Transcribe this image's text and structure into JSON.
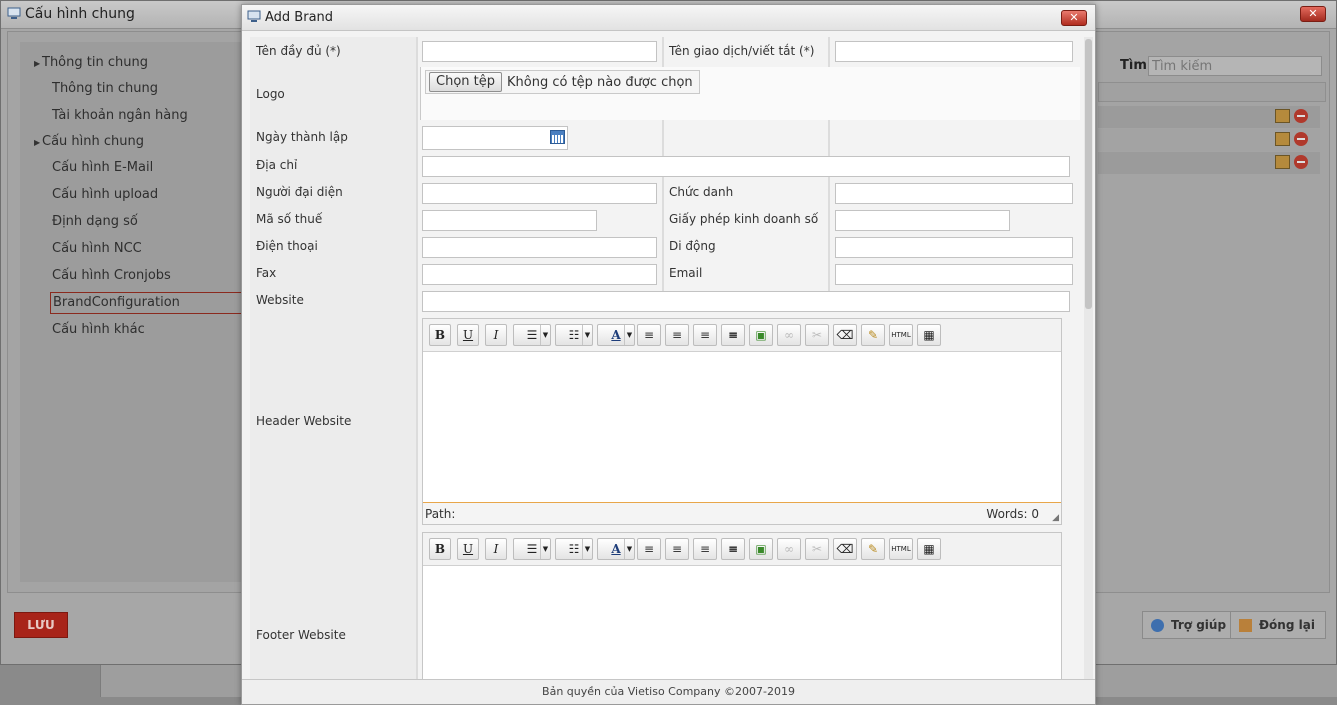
{
  "background_window": {
    "title": "Cấu hình chung",
    "sidebar": [
      {
        "label": "Thông tin chung",
        "type": "group"
      },
      {
        "label": "Thông tin chung",
        "type": "child"
      },
      {
        "label": "Tài khoản ngân hàng",
        "type": "child"
      },
      {
        "label": "Cấu hình chung",
        "type": "group"
      },
      {
        "label": "Cấu hình E-Mail",
        "type": "child"
      },
      {
        "label": "Cấu hình upload",
        "type": "child"
      },
      {
        "label": "Định dạng số",
        "type": "child"
      },
      {
        "label": "Cấu hình NCC",
        "type": "child"
      },
      {
        "label": "Cấu hình Cronjobs",
        "type": "child"
      },
      {
        "label": "BrandConfiguration",
        "type": "active"
      },
      {
        "label": "Cấu hình khác",
        "type": "child"
      }
    ],
    "search_label": "Tìm:",
    "search_placeholder": "Tìm kiếm",
    "save_label": "LƯU",
    "help_label": "Trợ giúp",
    "close_label": "Đóng lại"
  },
  "modal": {
    "title": "Add Brand",
    "fields": {
      "full_name": "Tên đầy đủ (*)",
      "trade_name": "Tên giao dịch/viết tắt (*)",
      "logo": "Logo",
      "file_button": "Chọn tệp",
      "file_status": "Không có tệp nào được chọn",
      "founded": "Ngày thành lập",
      "address": "Địa chỉ",
      "representative": "Người đại diện",
      "position": "Chức danh",
      "tax_code": "Mã số thuế",
      "business_license": "Giấy phép kinh doanh số",
      "phone": "Điện thoại",
      "mobile": "Di động",
      "fax": "Fax",
      "email": "Email",
      "website": "Website",
      "header_website": "Header Website",
      "footer_website": "Footer Website"
    },
    "editor": {
      "path_label": "Path:",
      "words_label": "Words: 0",
      "html_btn": "HTML"
    },
    "copyright": "Bản quyền của Vietiso Company ©2007-2019"
  }
}
